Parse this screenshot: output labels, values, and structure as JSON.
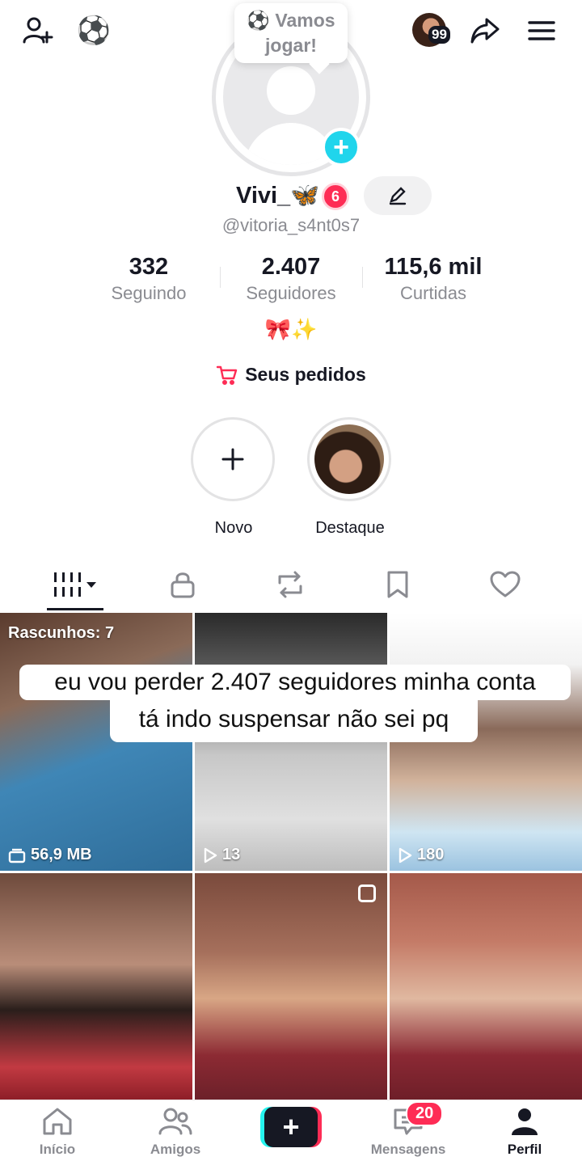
{
  "header": {
    "emoji": "⚽",
    "story_badge": "99"
  },
  "profile": {
    "bubble_text": "⚽ Vamos jogar!",
    "display_name": "Vivi_🦋",
    "level": "6",
    "username": "@vitoria_s4nt0s7",
    "stats": [
      {
        "value": "332",
        "label": "Seguindo"
      },
      {
        "value": "2.407",
        "label": "Seguidores"
      },
      {
        "value": "115,6 mil",
        "label": "Curtidas"
      }
    ],
    "bio": "🎀✨",
    "orders_label": "Seus pedidos"
  },
  "highlights": [
    {
      "label": "Novo"
    },
    {
      "label": "Destaque"
    }
  ],
  "grid": {
    "drafts_label": "Rascunhos: 7",
    "cells": [
      {
        "label": "56,9 MB"
      },
      {
        "label": "13"
      },
      {
        "label": "180"
      }
    ]
  },
  "caption": {
    "line1": "eu vou perder 2.407 seguidores minha conta",
    "line2": "tá indo suspensar não sei pq"
  },
  "nav": {
    "items": [
      {
        "label": "Início"
      },
      {
        "label": "Amigos"
      },
      {
        "label": "Mensagens"
      },
      {
        "label": "Perfil"
      }
    ],
    "messages_badge": "20"
  }
}
